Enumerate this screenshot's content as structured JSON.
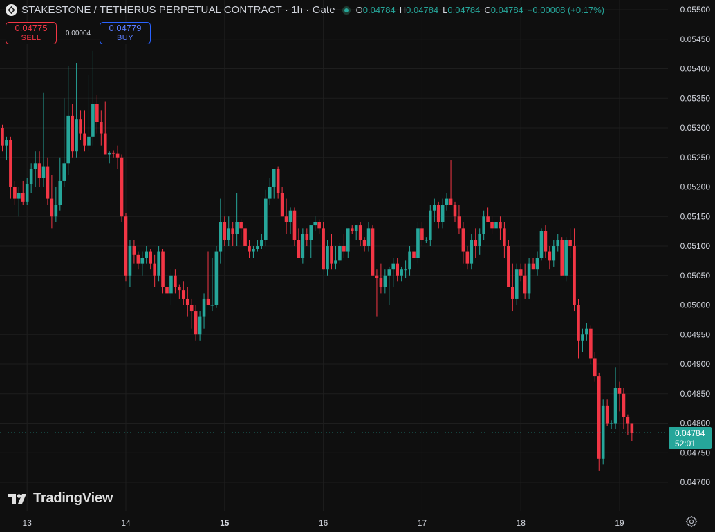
{
  "header": {
    "title": "STAKESTONE / TETHERUS PERPETUAL CONTRACT · 1h · Gate",
    "ohlc": {
      "o_label": "O",
      "o_value": "0.04784",
      "h_label": "H",
      "h_value": "0.04784",
      "l_label": "L",
      "l_value": "0.04784",
      "c_label": "C",
      "c_value": "0.04784",
      "change": "+0.00008 (+0.17%)"
    }
  },
  "trade": {
    "sell_price": "0.04775",
    "sell_label": "SELL",
    "spread": "0.00004",
    "buy_price": "0.04779",
    "buy_label": "BUY"
  },
  "last_price": {
    "value": "0.04784",
    "countdown": "52:01"
  },
  "branding": {
    "name": "TradingView"
  },
  "colors": {
    "up": "#26a69a",
    "down": "#f23645",
    "background": "#0f0f0f",
    "grid": "#1e1e1e"
  },
  "chart_data": {
    "type": "candlestick",
    "y_ticks": [
      "0.05500",
      "0.05450",
      "0.05400",
      "0.05350",
      "0.05300",
      "0.05250",
      "0.05200",
      "0.05150",
      "0.05100",
      "0.05050",
      "0.05000",
      "0.04950",
      "0.04900",
      "0.04850",
      "0.04800",
      "0.04750",
      "0.04700"
    ],
    "ylim": [
      0.04675,
      0.05515
    ],
    "x_ticks": [
      {
        "label": "13",
        "bar": 6,
        "bold": false
      },
      {
        "label": "14",
        "bar": 30,
        "bold": false
      },
      {
        "label": "15",
        "bar": 54,
        "bold": true
      },
      {
        "label": "16",
        "bar": 78,
        "bold": false
      },
      {
        "label": "17",
        "bar": 102,
        "bold": false
      },
      {
        "label": "18",
        "bar": 126,
        "bold": false
      },
      {
        "label": "19",
        "bar": 150,
        "bold": false
      }
    ],
    "candles": [
      [
        0.053,
        0.05305,
        0.0526,
        0.0527
      ],
      [
        0.0527,
        0.05285,
        0.05245,
        0.0528
      ],
      [
        0.0528,
        0.05285,
        0.0518,
        0.052
      ],
      [
        0.052,
        0.0521,
        0.0517,
        0.0518
      ],
      [
        0.0518,
        0.052,
        0.0515,
        0.0519
      ],
      [
        0.0519,
        0.0521,
        0.0517,
        0.05175
      ],
      [
        0.05175,
        0.05215,
        0.0517,
        0.05205
      ],
      [
        0.05205,
        0.0524,
        0.0519,
        0.0523
      ],
      [
        0.0523,
        0.0526,
        0.052,
        0.0524
      ],
      [
        0.0524,
        0.0526,
        0.052,
        0.05215
      ],
      [
        0.05215,
        0.0536,
        0.052,
        0.05235
      ],
      [
        0.05235,
        0.0525,
        0.0517,
        0.0518
      ],
      [
        0.0518,
        0.0522,
        0.0513,
        0.0515
      ],
      [
        0.0515,
        0.052,
        0.0514,
        0.0517
      ],
      [
        0.0517,
        0.0525,
        0.0516,
        0.0521
      ],
      [
        0.0521,
        0.0535,
        0.052,
        0.0524
      ],
      [
        0.0524,
        0.05405,
        0.0522,
        0.0532
      ],
      [
        0.0532,
        0.0534,
        0.0525,
        0.0526
      ],
      [
        0.0526,
        0.0541,
        0.0525,
        0.05315
      ],
      [
        0.05315,
        0.0533,
        0.0528,
        0.0529
      ],
      [
        0.0529,
        0.0533,
        0.0526,
        0.0527
      ],
      [
        0.0527,
        0.0539,
        0.0526,
        0.05285
      ],
      [
        0.05285,
        0.0543,
        0.0527,
        0.0534
      ],
      [
        0.0534,
        0.05355,
        0.0529,
        0.0531
      ],
      [
        0.0531,
        0.0533,
        0.0527,
        0.0529
      ],
      [
        0.0529,
        0.05345,
        0.0526,
        0.05255
      ],
      [
        0.05255,
        0.0526,
        0.0524,
        0.05258
      ],
      [
        0.05258,
        0.05262,
        0.0525,
        0.05256
      ],
      [
        0.05256,
        0.0527,
        0.0523,
        0.0525
      ],
      [
        0.0525,
        0.05255,
        0.0514,
        0.0515
      ],
      [
        0.0515,
        0.05155,
        0.0504,
        0.0505
      ],
      [
        0.0505,
        0.0511,
        0.0503,
        0.051
      ],
      [
        0.051,
        0.0511,
        0.0507,
        0.05085
      ],
      [
        0.05085,
        0.0509,
        0.0506,
        0.0507
      ],
      [
        0.0507,
        0.0509,
        0.0505,
        0.0508
      ],
      [
        0.0508,
        0.051,
        0.0507,
        0.0509
      ],
      [
        0.0509,
        0.05095,
        0.0506,
        0.0507
      ],
      [
        0.0507,
        0.05085,
        0.0503,
        0.0505
      ],
      [
        0.0505,
        0.051,
        0.0504,
        0.0509
      ],
      [
        0.0509,
        0.05095,
        0.0502,
        0.0503
      ],
      [
        0.0503,
        0.0504,
        0.0501,
        0.0502
      ],
      [
        0.0502,
        0.0506,
        0.05,
        0.0505
      ],
      [
        0.0505,
        0.0506,
        0.0502,
        0.0503
      ],
      [
        0.0503,
        0.05035,
        0.0501,
        0.05025
      ],
      [
        0.05025,
        0.0504,
        0.05,
        0.0501
      ],
      [
        0.0501,
        0.0503,
        0.0498,
        0.05
      ],
      [
        0.05,
        0.0501,
        0.0496,
        0.0499
      ],
      [
        0.0499,
        0.05,
        0.0494,
        0.0495
      ],
      [
        0.0495,
        0.0499,
        0.0494,
        0.0498
      ],
      [
        0.0498,
        0.0502,
        0.0496,
        0.0501
      ],
      [
        0.0501,
        0.0509,
        0.05,
        0.05
      ],
      [
        0.05,
        0.0508,
        0.0499,
        0.05
      ],
      [
        0.05,
        0.051,
        0.04995,
        0.0509
      ],
      [
        0.0509,
        0.0518,
        0.0507,
        0.0514
      ],
      [
        0.0514,
        0.0515,
        0.051,
        0.0511
      ],
      [
        0.0511,
        0.0515,
        0.051,
        0.0513
      ],
      [
        0.0513,
        0.0514,
        0.051,
        0.0512
      ],
      [
        0.0512,
        0.0519,
        0.051,
        0.0514
      ],
      [
        0.0514,
        0.05145,
        0.0511,
        0.0513
      ],
      [
        0.0513,
        0.05135,
        0.051,
        0.051
      ],
      [
        0.051,
        0.0511,
        0.0508,
        0.0509
      ],
      [
        0.0509,
        0.051,
        0.0508,
        0.05095
      ],
      [
        0.05095,
        0.0511,
        0.0509,
        0.051
      ],
      [
        0.051,
        0.0512,
        0.05095,
        0.0511
      ],
      [
        0.0511,
        0.05195,
        0.051,
        0.0518
      ],
      [
        0.0518,
        0.05215,
        0.0517,
        0.052
      ],
      [
        0.052,
        0.0523,
        0.0518,
        0.0523
      ],
      [
        0.0523,
        0.05235,
        0.0518,
        0.0519
      ],
      [
        0.0519,
        0.052,
        0.0515,
        0.0515
      ],
      [
        0.0515,
        0.0518,
        0.0512,
        0.0514
      ],
      [
        0.0514,
        0.05165,
        0.0512,
        0.0516
      ],
      [
        0.0516,
        0.05165,
        0.051,
        0.0511
      ],
      [
        0.0511,
        0.0513,
        0.0508,
        0.0508
      ],
      [
        0.0508,
        0.0513,
        0.0507,
        0.0512
      ],
      [
        0.0512,
        0.0513,
        0.051,
        0.0511
      ],
      [
        0.0511,
        0.05135,
        0.0508,
        0.05135
      ],
      [
        0.05135,
        0.0515,
        0.05125,
        0.0514
      ],
      [
        0.0514,
        0.05145,
        0.0512,
        0.0513
      ],
      [
        0.0513,
        0.0514,
        0.0506,
        0.0506
      ],
      [
        0.0506,
        0.0511,
        0.0505,
        0.051
      ],
      [
        0.051,
        0.0512,
        0.0506,
        0.0507
      ],
      [
        0.0507,
        0.051,
        0.0506,
        0.05075
      ],
      [
        0.05075,
        0.05105,
        0.0507,
        0.051
      ],
      [
        0.051,
        0.0512,
        0.0508,
        0.0509
      ],
      [
        0.0509,
        0.0513,
        0.0508,
        0.0513
      ],
      [
        0.0513,
        0.05135,
        0.0512,
        0.05125
      ],
      [
        0.05125,
        0.05135,
        0.0511,
        0.05135
      ],
      [
        0.05135,
        0.0514,
        0.051,
        0.0511
      ],
      [
        0.0511,
        0.05115,
        0.0509,
        0.051
      ],
      [
        0.051,
        0.0514,
        0.0509,
        0.0513
      ],
      [
        0.0513,
        0.05135,
        0.0505,
        0.0505
      ],
      [
        0.0505,
        0.0506,
        0.0498,
        0.05045
      ],
      [
        0.05045,
        0.0507,
        0.0502,
        0.0503
      ],
      [
        0.0503,
        0.0506,
        0.0502,
        0.0505
      ],
      [
        0.0505,
        0.05065,
        0.05,
        0.0506
      ],
      [
        0.0506,
        0.0508,
        0.0503,
        0.0507
      ],
      [
        0.0507,
        0.0508,
        0.0504,
        0.0505
      ],
      [
        0.0505,
        0.05065,
        0.0504,
        0.0506
      ],
      [
        0.0506,
        0.05075,
        0.05045,
        0.0506
      ],
      [
        0.0506,
        0.051,
        0.0505,
        0.0509
      ],
      [
        0.0509,
        0.05095,
        0.0507,
        0.0508
      ],
      [
        0.0508,
        0.0514,
        0.0507,
        0.0513
      ],
      [
        0.0513,
        0.0514,
        0.051,
        0.0511
      ],
      [
        0.0511,
        0.05115,
        0.05105,
        0.0511
      ],
      [
        0.0511,
        0.0517,
        0.051,
        0.0516
      ],
      [
        0.0516,
        0.0518,
        0.0514,
        0.0517
      ],
      [
        0.0517,
        0.05175,
        0.0513,
        0.0514
      ],
      [
        0.0514,
        0.0518,
        0.0513,
        0.0517
      ],
      [
        0.0517,
        0.0519,
        0.0516,
        0.0518
      ],
      [
        0.0518,
        0.05245,
        0.0517,
        0.0517
      ],
      [
        0.0517,
        0.05175,
        0.0514,
        0.0515
      ],
      [
        0.0515,
        0.0517,
        0.0512,
        0.0513
      ],
      [
        0.0513,
        0.0514,
        0.0507,
        0.0509
      ],
      [
        0.0509,
        0.051,
        0.0506,
        0.0507
      ],
      [
        0.0507,
        0.0512,
        0.0506,
        0.0511
      ],
      [
        0.0511,
        0.0513,
        0.0508,
        0.051
      ],
      [
        0.051,
        0.0513,
        0.05085,
        0.0512
      ],
      [
        0.0512,
        0.0516,
        0.0511,
        0.0515
      ],
      [
        0.0515,
        0.05165,
        0.0514,
        0.0514
      ],
      [
        0.0514,
        0.0515,
        0.0512,
        0.0513
      ],
      [
        0.0513,
        0.0516,
        0.051,
        0.0514
      ],
      [
        0.0514,
        0.0515,
        0.0511,
        0.0513
      ],
      [
        0.0513,
        0.0514,
        0.0508,
        0.051
      ],
      [
        0.051,
        0.0511,
        0.0505,
        0.0503
      ],
      [
        0.0503,
        0.0507,
        0.0499,
        0.0501
      ],
      [
        0.0501,
        0.0507,
        0.05,
        0.0506
      ],
      [
        0.0506,
        0.0507,
        0.0504,
        0.0505
      ],
      [
        0.0505,
        0.0507,
        0.0501,
        0.0502
      ],
      [
        0.0502,
        0.0508,
        0.0501,
        0.0507
      ],
      [
        0.0507,
        0.0508,
        0.0506,
        0.0506
      ],
      [
        0.0506,
        0.0509,
        0.0505,
        0.0508
      ],
      [
        0.0508,
        0.0513,
        0.05075,
        0.05125
      ],
      [
        0.05125,
        0.05135,
        0.0508,
        0.0509
      ],
      [
        0.0509,
        0.051,
        0.0506,
        0.05075
      ],
      [
        0.05075,
        0.0511,
        0.05065,
        0.051
      ],
      [
        0.051,
        0.0512,
        0.0509,
        0.0511
      ],
      [
        0.0511,
        0.05115,
        0.0505,
        0.0505
      ],
      [
        0.0505,
        0.05115,
        0.0504,
        0.0511
      ],
      [
        0.0511,
        0.0513,
        0.0508,
        0.051
      ],
      [
        0.051,
        0.0513,
        0.0499,
        0.05
      ],
      [
        0.05,
        0.0501,
        0.0491,
        0.0494
      ],
      [
        0.0494,
        0.0496,
        0.0492,
        0.0495
      ],
      [
        0.0495,
        0.0497,
        0.0494,
        0.0496
      ],
      [
        0.0496,
        0.04965,
        0.049,
        0.0491
      ],
      [
        0.0491,
        0.0492,
        0.0487,
        0.0488
      ],
      [
        0.0488,
        0.04885,
        0.0472,
        0.0474
      ],
      [
        0.0474,
        0.0484,
        0.0473,
        0.0483
      ],
      [
        0.0483,
        0.0484,
        0.04795,
        0.048
      ],
      [
        0.048,
        0.04805,
        0.0479,
        0.048
      ],
      [
        0.048,
        0.04895,
        0.0479,
        0.0486
      ],
      [
        0.0486,
        0.0487,
        0.0482,
        0.0485
      ],
      [
        0.0485,
        0.0486,
        0.0479,
        0.0481
      ],
      [
        0.0481,
        0.04815,
        0.0478,
        0.048
      ],
      [
        0.048,
        0.04795,
        0.0477,
        0.04784
      ]
    ]
  }
}
